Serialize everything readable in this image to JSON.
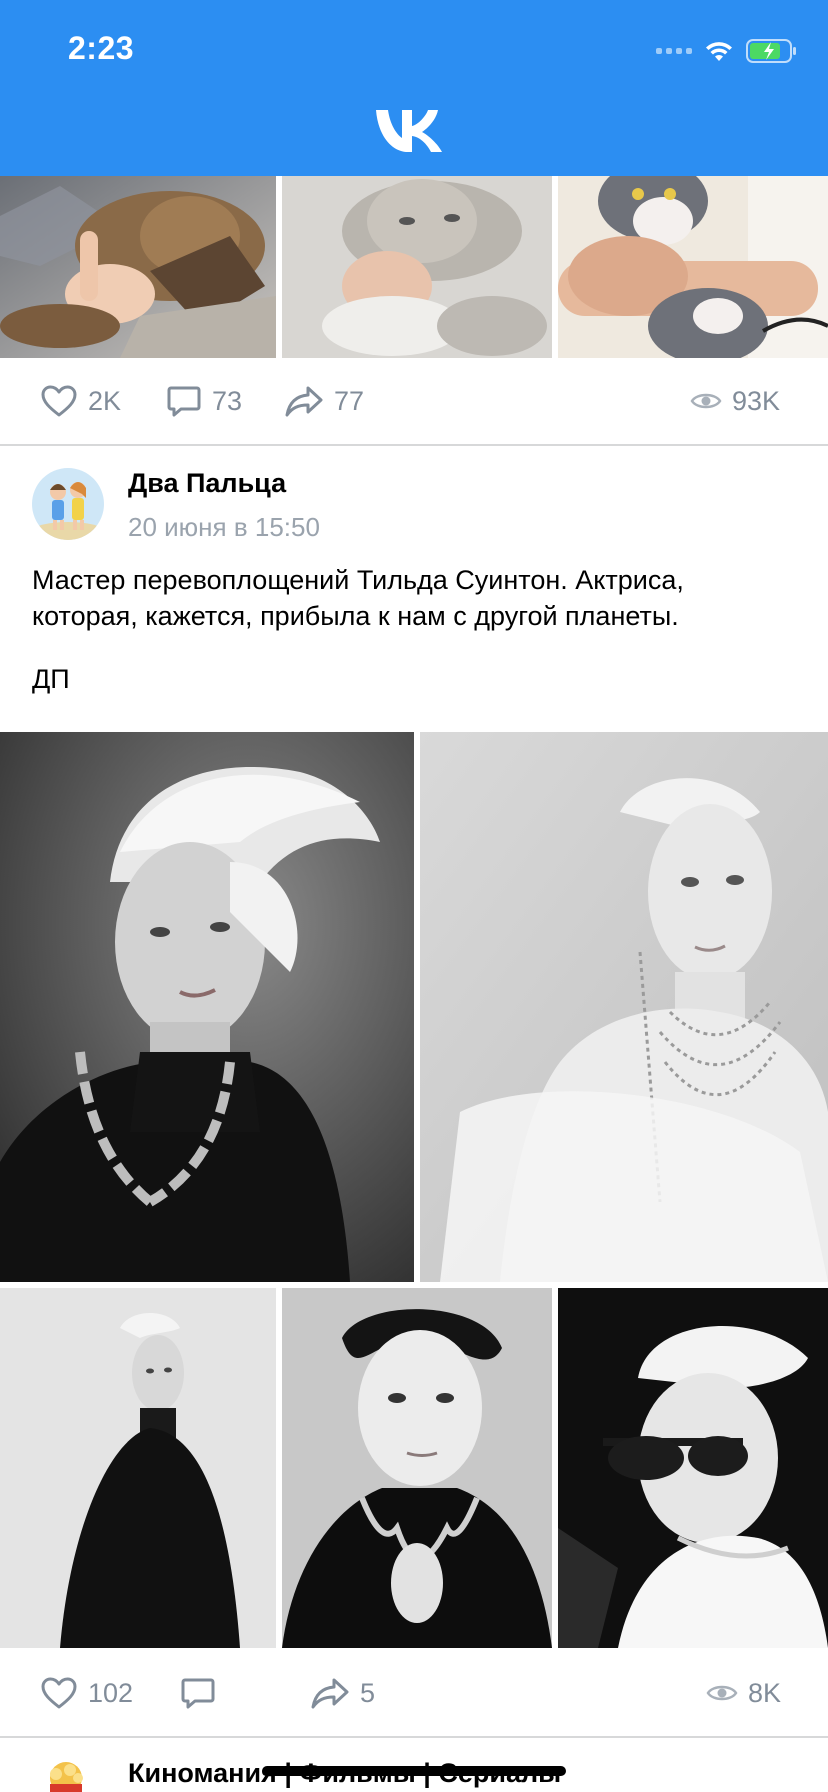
{
  "status_bar": {
    "time": "2:23"
  },
  "header": {
    "logo": "vk-logo",
    "color": "#2c8ef2"
  },
  "prev_post": {
    "photos": [
      "cat-biting-hand-photo",
      "grey-cat-biting-hand-photo",
      "kitten-biting-arm-photo"
    ],
    "actions": {
      "likes": "2K",
      "comments": "73",
      "shares": "77",
      "views": "93K"
    }
  },
  "post": {
    "author": "Два Пальца",
    "date": "20 июня в 15:50",
    "text": "Мастер перевоплощений Тильда Суинтон. Актриса, которая, кажется, прибыла к нам с другой планеты.",
    "signature": "ДП",
    "photos": [
      "tilda-swinton-necklace-photo",
      "tilda-swinton-jewels-photo",
      "tilda-swinton-black-coat-photo",
      "tilda-swinton-dark-hair-photo",
      "tilda-swinton-sunglasses-photo"
    ],
    "actions": {
      "likes": "102",
      "comments": "",
      "shares": "5",
      "views": "8K"
    }
  },
  "next_post": {
    "author": "Киномания | Фильмы | Сериалы"
  },
  "colors": {
    "action_gray": "#818c99",
    "date_gray": "#9aa3ad",
    "divider": "#d7d8d9"
  }
}
